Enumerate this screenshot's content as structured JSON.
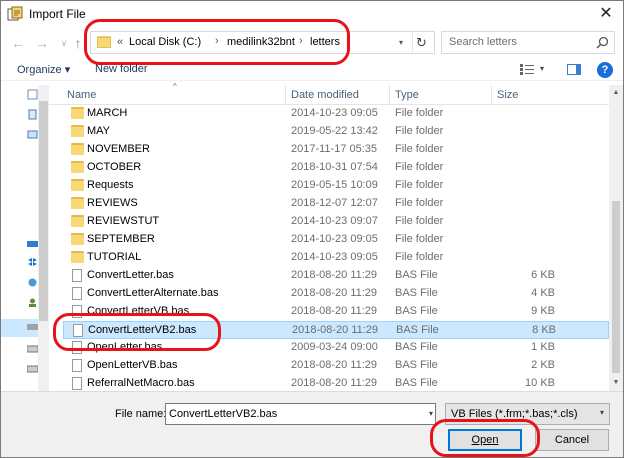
{
  "window": {
    "title": "Import File",
    "close_glyph": "✕"
  },
  "nav": {
    "back_glyph": "←",
    "forward_glyph": "→",
    "recent_glyph": "∨",
    "up_glyph": "↑",
    "address": {
      "prefix": "«",
      "segments": [
        "Local Disk (C:)",
        "medilink32bnt",
        "letters"
      ],
      "separator": "›",
      "dropdown_glyph": "▾",
      "refresh_glyph": "↻"
    },
    "search_placeholder": "Search letters"
  },
  "toolbar": {
    "organize_label": "Organize ▾",
    "new_folder_label": "New folder",
    "view_dropdown_glyph": "▾",
    "help_label": "?"
  },
  "columns": {
    "name": "Name",
    "date_modified": "Date modified",
    "type": "Type",
    "size": "Size",
    "sort_glyph": "^"
  },
  "files": [
    {
      "name": "MARCH",
      "date": "2014-10-23 09:05",
      "type": "File folder",
      "size": "",
      "kind": "folder"
    },
    {
      "name": "MAY",
      "date": "2019-05-22 13:42",
      "type": "File folder",
      "size": "",
      "kind": "folder"
    },
    {
      "name": "NOVEMBER",
      "date": "2017-11-17 05:35",
      "type": "File folder",
      "size": "",
      "kind": "folder"
    },
    {
      "name": "OCTOBER",
      "date": "2018-10-31 07:54",
      "type": "File folder",
      "size": "",
      "kind": "folder"
    },
    {
      "name": "Requests",
      "date": "2019-05-15 10:09",
      "type": "File folder",
      "size": "",
      "kind": "folder"
    },
    {
      "name": "REVIEWS",
      "date": "2018-12-07 12:07",
      "type": "File folder",
      "size": "",
      "kind": "folder"
    },
    {
      "name": "REVIEWSTUT",
      "date": "2014-10-23 09:07",
      "type": "File folder",
      "size": "",
      "kind": "folder"
    },
    {
      "name": "SEPTEMBER",
      "date": "2014-10-23 09:05",
      "type": "File folder",
      "size": "",
      "kind": "folder"
    },
    {
      "name": "TUTORIAL",
      "date": "2014-10-23 09:05",
      "type": "File folder",
      "size": "",
      "kind": "folder"
    },
    {
      "name": "ConvertLetter.bas",
      "date": "2018-08-20 11:29",
      "type": "BAS File",
      "size": "6 KB",
      "kind": "file"
    },
    {
      "name": "ConvertLetterAlternate.bas",
      "date": "2018-08-20 11:29",
      "type": "BAS File",
      "size": "4 KB",
      "kind": "file"
    },
    {
      "name": "ConvertLetterVB.bas",
      "date": "2018-08-20 11:29",
      "type": "BAS File",
      "size": "9 KB",
      "kind": "file"
    },
    {
      "name": "ConvertLetterVB2.bas",
      "date": "2018-08-20 11:29",
      "type": "BAS File",
      "size": "8 KB",
      "kind": "file",
      "selected": true
    },
    {
      "name": "OpenLetter.bas",
      "date": "2009-03-24 09:00",
      "type": "BAS File",
      "size": "1 KB",
      "kind": "file"
    },
    {
      "name": "OpenLetterVB.bas",
      "date": "2018-08-20 11:29",
      "type": "BAS File",
      "size": "2 KB",
      "kind": "file"
    },
    {
      "name": "ReferralNetMacro.bas",
      "date": "2018-08-20 11:29",
      "type": "BAS File",
      "size": "10 KB",
      "kind": "file"
    }
  ],
  "footer": {
    "file_name_label": "File name:",
    "file_name_value": "ConvertLetterVB2.bas",
    "file_type_value": "VB Files (*.frm;*.bas;*.cls)",
    "dropdown_glyph": "▾",
    "open_label": "Open",
    "cancel_label": "Cancel"
  },
  "colors": {
    "selection": "#cce8ff",
    "annotation_red": "#e8131a",
    "folder": "#f8d775",
    "link_blue": "#1e395b"
  }
}
